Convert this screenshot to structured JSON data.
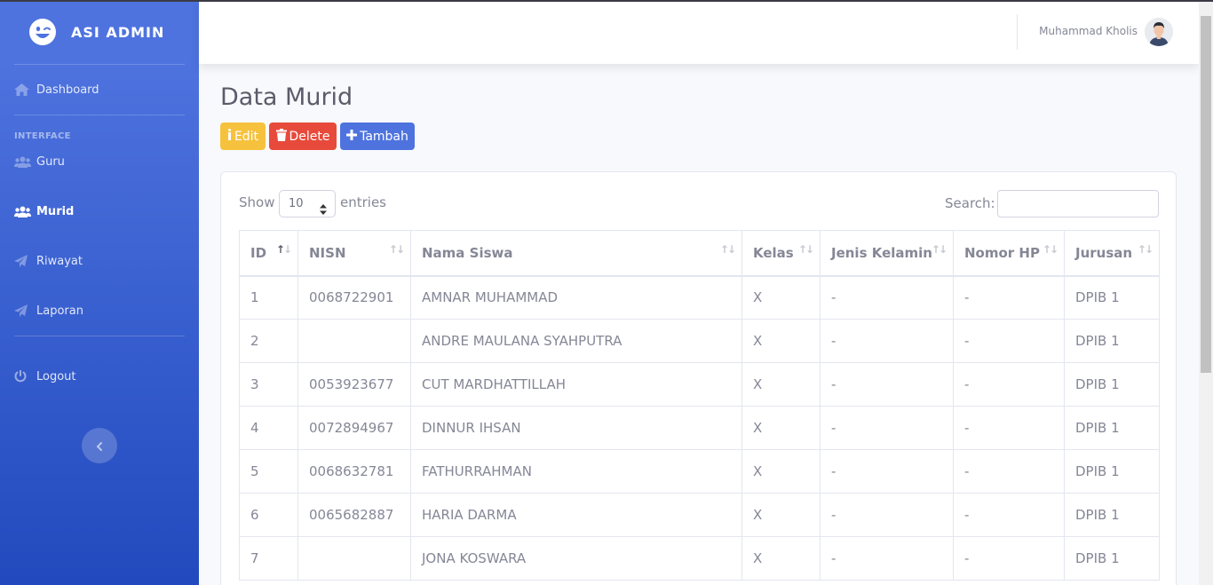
{
  "sidebar": {
    "brand": "ASI ADMIN",
    "items": [
      {
        "label": "Dashboard",
        "icon": "home-icon"
      },
      {
        "label": "Guru",
        "icon": "users-icon"
      },
      {
        "label": "Murid",
        "icon": "users-icon",
        "active": true
      },
      {
        "label": "Riwayat",
        "icon": "paper-plane-icon"
      },
      {
        "label": "Laporan",
        "icon": "paper-plane-icon"
      },
      {
        "label": "Logout",
        "icon": "power-icon"
      }
    ],
    "heading_interface": "INTERFACE"
  },
  "topbar": {
    "username": "Muhammad Kholis"
  },
  "page": {
    "title": "Data Murid",
    "buttons": {
      "edit": "Edit",
      "delete": "Delete",
      "add": "Tambah"
    }
  },
  "table_controls": {
    "show": "Show",
    "entries_value": "10",
    "entries": "entries",
    "search": "Search:"
  },
  "table": {
    "headers": [
      "ID",
      "NISN",
      "Nama Siswa",
      "Kelas",
      "Jenis Kelamin",
      "Nomor HP",
      "Jurusan"
    ],
    "rows": [
      [
        "1",
        "0068722901",
        "AMNAR MUHAMMAD",
        "X",
        "-",
        "-",
        "DPIB 1"
      ],
      [
        "2",
        "",
        "ANDRE MAULANA SYAHPUTRA",
        "X",
        "-",
        "-",
        "DPIB 1"
      ],
      [
        "3",
        "0053923677",
        "CUT MARDHATTILLAH",
        "X",
        "-",
        "-",
        "DPIB 1"
      ],
      [
        "4",
        "0072894967",
        "DINNUR IHSAN",
        "X",
        "-",
        "-",
        "DPIB 1"
      ],
      [
        "5",
        "0068632781",
        "FATHURRAHMAN",
        "X",
        "-",
        "-",
        "DPIB 1"
      ],
      [
        "6",
        "0065682887",
        "HARIA DARMA",
        "X",
        "-",
        "-",
        "DPIB 1"
      ],
      [
        "7",
        "",
        "JONA KOSWARA",
        "X",
        "-",
        "-",
        "DPIB 1"
      ]
    ]
  },
  "colors": {
    "primary": "#4e73df",
    "warning": "#f6c23e",
    "danger": "#e74a3b",
    "background": "#f8f9fc"
  }
}
